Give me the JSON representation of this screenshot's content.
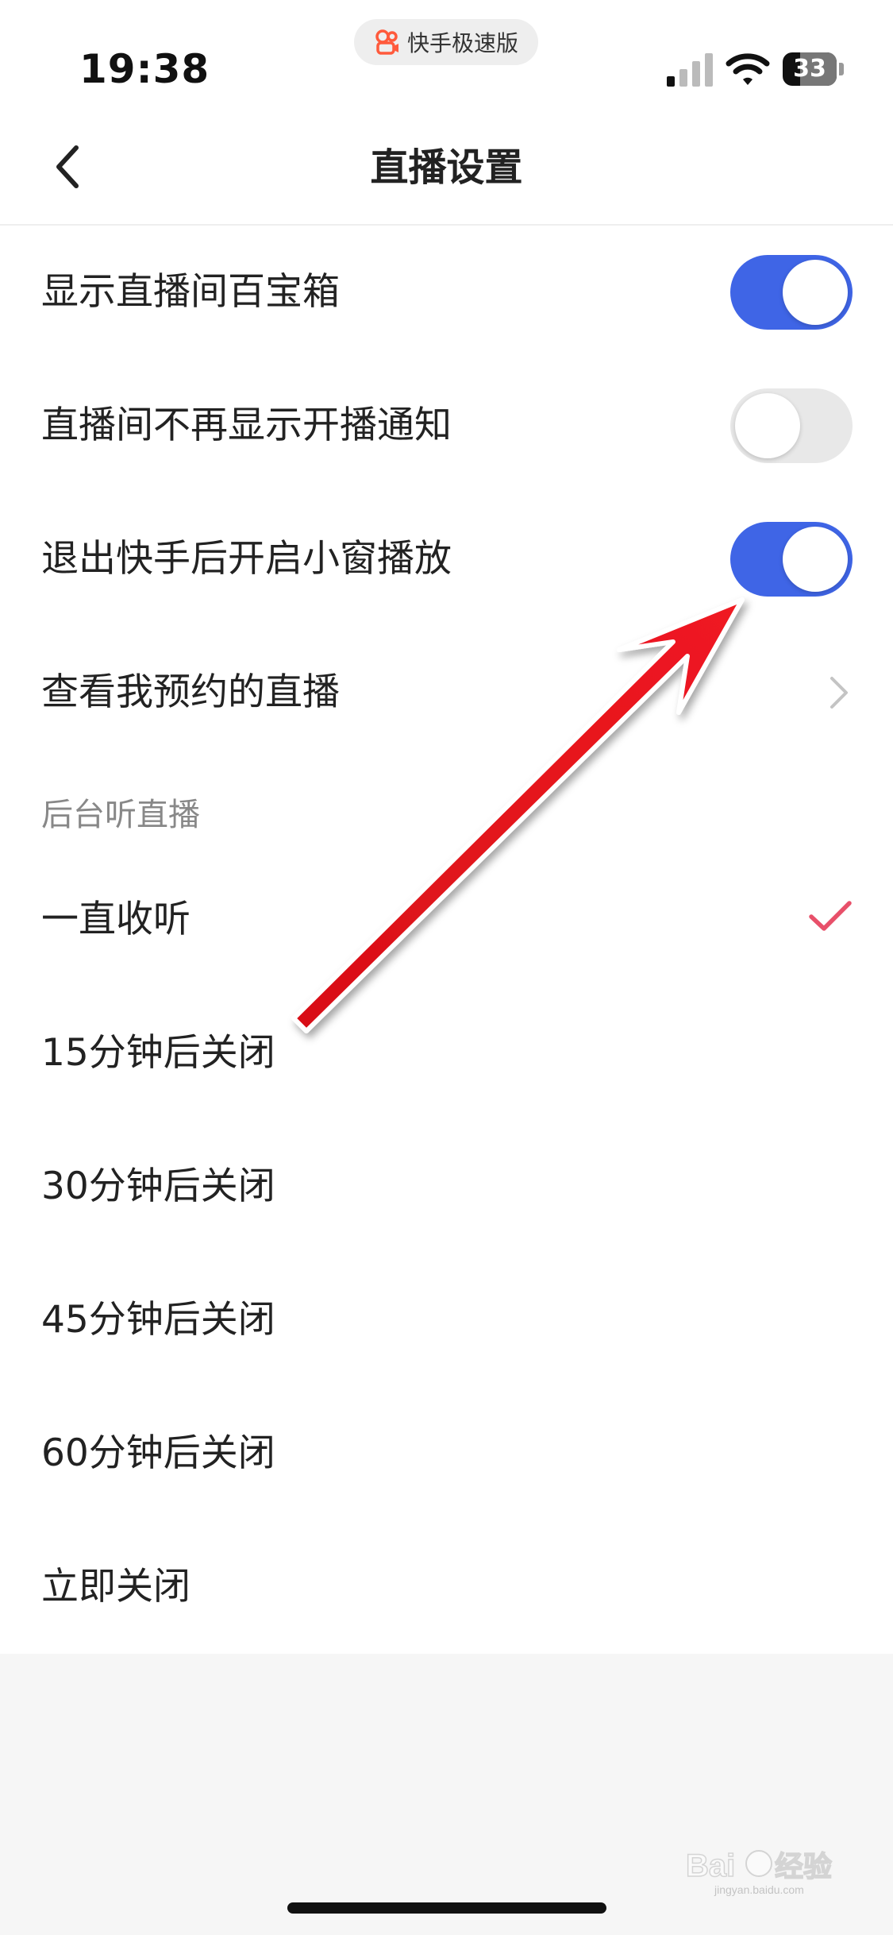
{
  "status_bar": {
    "time": "19:38",
    "app_pill_label": "快手极速版",
    "battery_level": "33",
    "battery_fraction": 0.33
  },
  "nav": {
    "title": "直播设置",
    "back_icon": "chevron-left-icon"
  },
  "settings": [
    {
      "label": "显示直播间百宝箱",
      "control": "toggle",
      "state": "on"
    },
    {
      "label": "直播间不再显示开播通知",
      "control": "toggle",
      "state": "off"
    },
    {
      "label": "退出快手后开启小窗播放",
      "control": "toggle",
      "state": "on"
    },
    {
      "label": "查看我预约的直播",
      "control": "chevron",
      "icon": "chevron-right-icon"
    }
  ],
  "background_listen": {
    "header": "后台听直播",
    "options": [
      {
        "label": "一直收听",
        "selected": true
      },
      {
        "label": "15分钟后关闭",
        "selected": false
      },
      {
        "label": "30分钟后关闭",
        "selected": false
      },
      {
        "label": "45分钟后关闭",
        "selected": false
      },
      {
        "label": "60分钟后关闭",
        "selected": false
      },
      {
        "label": "立即关闭",
        "selected": false
      }
    ]
  },
  "colors": {
    "toggle_on": "#3f65e6",
    "toggle_off": "#e8e8e8",
    "check_mark": "#e8506a",
    "annotation_arrow": "#e8121a"
  },
  "watermark": {
    "text": "Baidu经验",
    "subtext": "jingyan.baidu.com"
  }
}
